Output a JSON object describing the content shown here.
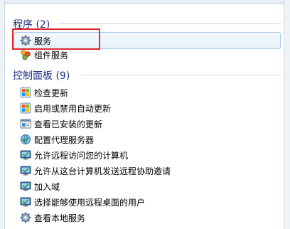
{
  "sections": [
    {
      "title": "程序 (2)",
      "items": [
        "服务",
        "组件服务"
      ]
    },
    {
      "title": "控制面板 (9)",
      "items": [
        "检查更新",
        "启用或禁用自动更新",
        "查看已安装的更新",
        "配置代理服务器",
        "允许远程访问您的计算机",
        "允许从这台计算机发送远程协助邀请",
        "加入域",
        "选择能够使用远程桌面的用户",
        "查看本地服务"
      ]
    }
  ],
  "icons": {
    "services": "gear-icon",
    "component_services": "component-services-icon",
    "check_updates": "windows-update-icon",
    "auto_update": "windows-update-icon",
    "installed_updates": "installed-updates-icon",
    "proxy": "proxy-network-icon",
    "remote": "remote-computer-icon",
    "local_services": "gear-icon"
  },
  "colors": {
    "section_title": "#1e3287",
    "selection_bg": "#e6f0fb",
    "selection_border": "#a8c8ea",
    "annotation": "#e0262b"
  }
}
